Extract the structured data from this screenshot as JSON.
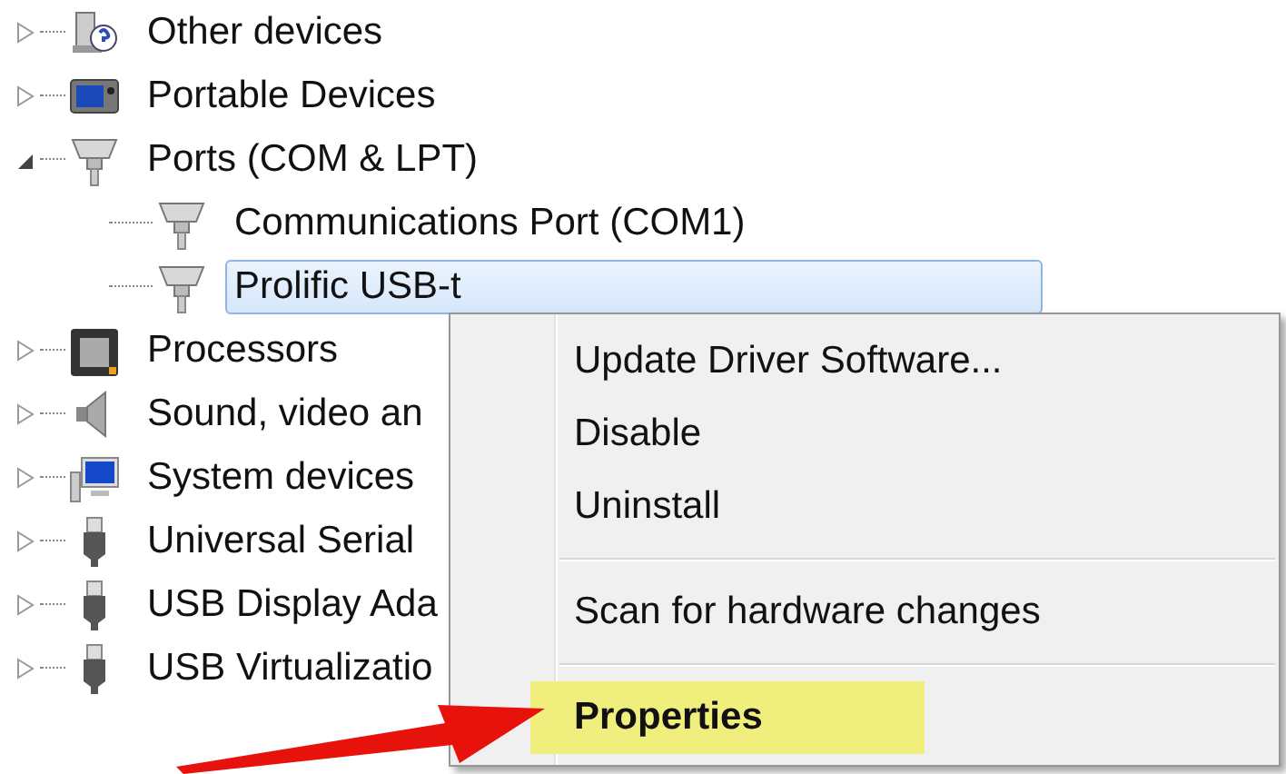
{
  "tree": [
    {
      "label": "Other devices",
      "kind": "unknown",
      "expanded": false,
      "selected": false
    },
    {
      "label": "Portable Devices",
      "kind": "portable",
      "expanded": false,
      "selected": false
    },
    {
      "label": "Ports (COM & LPT)",
      "kind": "port",
      "expanded": true,
      "selected": false,
      "children": [
        {
          "label": "Communications Port (COM1)",
          "kind": "port",
          "selected": false
        },
        {
          "label": "Prolific USB-t",
          "kind": "port",
          "selected": true
        }
      ]
    },
    {
      "label": "Processors",
      "kind": "chip",
      "expanded": false,
      "selected": false
    },
    {
      "label": "Sound, video an",
      "kind": "speaker",
      "expanded": false,
      "selected": false
    },
    {
      "label": "System devices",
      "kind": "monitor",
      "expanded": false,
      "selected": false
    },
    {
      "label": "Universal Serial",
      "kind": "usb",
      "expanded": false,
      "selected": false
    },
    {
      "label": "USB Display Ada",
      "kind": "usb",
      "expanded": false,
      "selected": false
    },
    {
      "label": "USB Virtualizatio",
      "kind": "usb",
      "expanded": false,
      "selected": false
    }
  ],
  "context_menu": [
    {
      "kind": "item",
      "label": "Update Driver Software...",
      "bold": false,
      "highlighted": false
    },
    {
      "kind": "item",
      "label": "Disable",
      "bold": false,
      "highlighted": false
    },
    {
      "kind": "item",
      "label": "Uninstall",
      "bold": false,
      "highlighted": false
    },
    {
      "kind": "separator"
    },
    {
      "kind": "item",
      "label": "Scan for hardware changes",
      "bold": false,
      "highlighted": false
    },
    {
      "kind": "separator"
    },
    {
      "kind": "item",
      "label": "Properties",
      "bold": true,
      "highlighted": true
    }
  ]
}
